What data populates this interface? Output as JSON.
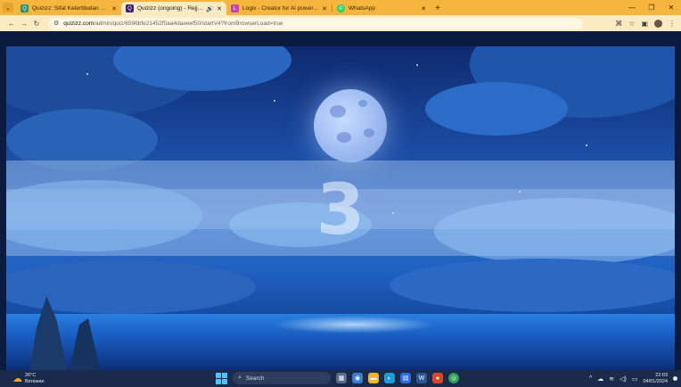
{
  "browser": {
    "tabs": [
      {
        "title": "Quizizz: Sifat Ketertibatan Sis…",
        "favicon_color": "#2f8f6a",
        "active": false
      },
      {
        "title": "Quizizz (ongoing) - Rejjolar",
        "favicon_color": "#3b1f6b",
        "active": true,
        "audio": true
      },
      {
        "title": "Logix - Creator for AI powered…",
        "favicon_color": "#c43fb0",
        "active": false
      },
      {
        "title": "WhatsApp",
        "favicon_color": "#25d366",
        "active": false
      }
    ],
    "url_host": "quizizz.com",
    "url_path": "/admin/quiz/6596bfe21452f0aa4daeeef50/startV4?fromBrowserLoad=true"
  },
  "quiz": {
    "countdown": "3"
  },
  "taskbar": {
    "weather_temp": "26°C",
    "weather_desc": "Berawan",
    "search_placeholder": "Search",
    "time": "22:03",
    "date": "04/01/2024"
  },
  "colors": {
    "tabstrip": "#f5b53e",
    "toolbar": "#fbeac2",
    "taskbar": "#1b2a4a"
  }
}
